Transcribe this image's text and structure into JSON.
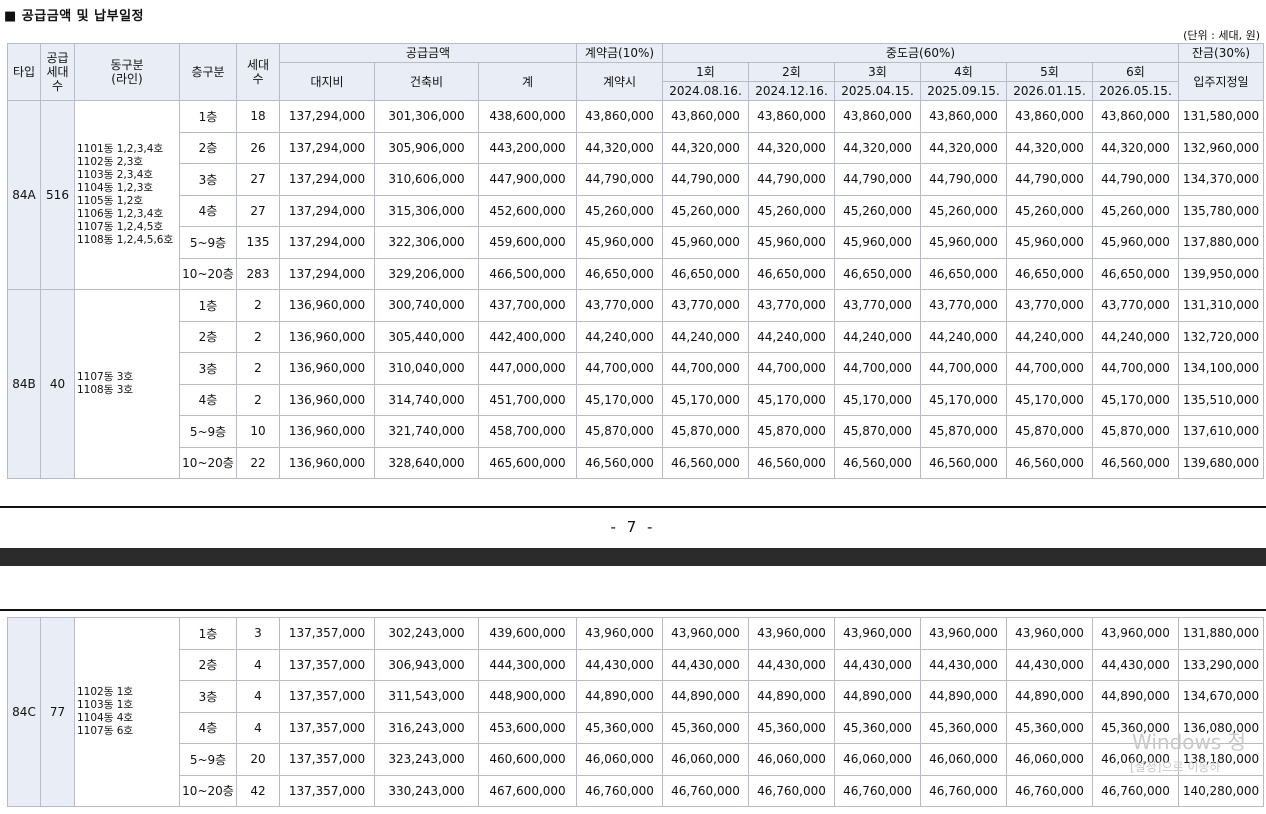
{
  "section_title": "■ 공급금액 및 납부일정",
  "unit_note": "(단위 : 세대, 원)",
  "headers": {
    "type": "타입",
    "supply_units": "공급\n세대\n수",
    "dong": "동구분\n(라인)",
    "floor": "층구분",
    "households": "세대\n수",
    "supply_amount": "공급금액",
    "land": "대지비",
    "building": "건축비",
    "total": "계",
    "deposit": "계약금(10%)",
    "deposit_sub": "계약시",
    "middle": "중도금(60%)",
    "rounds": [
      "1회",
      "2회",
      "3회",
      "4회",
      "5회",
      "6회"
    ],
    "dates": [
      "2024.08.16.",
      "2024.12.16.",
      "2025.04.15.",
      "2025.09.15.",
      "2026.01.15.",
      "2026.05.15."
    ],
    "balance": "잔금(30%)",
    "balance_sub": "입주지정일"
  },
  "page_number": "- 7 -",
  "watermark": {
    "line1": "Windows 정",
    "line2": "[설정]으로 이동하"
  },
  "groups": [
    {
      "type": "84A",
      "supply": "516",
      "dong": "1101동 1,2,3,4호\n1102동 2,3호\n1103동 2,3,4호\n1104동 1,2,3호\n1105동 1,2호\n1106동 1,2,3,4호\n1107동 1,2,4,5호\n1108동 1,2,4,5,6호",
      "rows": [
        {
          "floor": "1층",
          "hh": "18",
          "land": "137,294,000",
          "build": "301,306,000",
          "total": "438,600,000",
          "dep": "43,860,000",
          "mid": "43,860,000",
          "bal": "131,580,000"
        },
        {
          "floor": "2층",
          "hh": "26",
          "land": "137,294,000",
          "build": "305,906,000",
          "total": "443,200,000",
          "dep": "44,320,000",
          "mid": "44,320,000",
          "bal": "132,960,000"
        },
        {
          "floor": "3층",
          "hh": "27",
          "land": "137,294,000",
          "build": "310,606,000",
          "total": "447,900,000",
          "dep": "44,790,000",
          "mid": "44,790,000",
          "bal": "134,370,000"
        },
        {
          "floor": "4층",
          "hh": "27",
          "land": "137,294,000",
          "build": "315,306,000",
          "total": "452,600,000",
          "dep": "45,260,000",
          "mid": "45,260,000",
          "bal": "135,780,000"
        },
        {
          "floor": "5~9층",
          "hh": "135",
          "land": "137,294,000",
          "build": "322,306,000",
          "total": "459,600,000",
          "dep": "45,960,000",
          "mid": "45,960,000",
          "bal": "137,880,000"
        },
        {
          "floor": "10~20층",
          "hh": "283",
          "land": "137,294,000",
          "build": "329,206,000",
          "total": "466,500,000",
          "dep": "46,650,000",
          "mid": "46,650,000",
          "bal": "139,950,000"
        }
      ]
    },
    {
      "type": "84B",
      "supply": "40",
      "dong": "1107동 3호\n1108동 3호",
      "rows": [
        {
          "floor": "1층",
          "hh": "2",
          "land": "136,960,000",
          "build": "300,740,000",
          "total": "437,700,000",
          "dep": "43,770,000",
          "mid": "43,770,000",
          "bal": "131,310,000"
        },
        {
          "floor": "2층",
          "hh": "2",
          "land": "136,960,000",
          "build": "305,440,000",
          "total": "442,400,000",
          "dep": "44,240,000",
          "mid": "44,240,000",
          "bal": "132,720,000"
        },
        {
          "floor": "3층",
          "hh": "2",
          "land": "136,960,000",
          "build": "310,040,000",
          "total": "447,000,000",
          "dep": "44,700,000",
          "mid": "44,700,000",
          "bal": "134,100,000"
        },
        {
          "floor": "4층",
          "hh": "2",
          "land": "136,960,000",
          "build": "314,740,000",
          "total": "451,700,000",
          "dep": "45,170,000",
          "mid": "45,170,000",
          "bal": "135,510,000"
        },
        {
          "floor": "5~9층",
          "hh": "10",
          "land": "136,960,000",
          "build": "321,740,000",
          "total": "458,700,000",
          "dep": "45,870,000",
          "mid": "45,870,000",
          "bal": "137,610,000"
        },
        {
          "floor": "10~20층",
          "hh": "22",
          "land": "136,960,000",
          "build": "328,640,000",
          "total": "465,600,000",
          "dep": "46,560,000",
          "mid": "46,560,000",
          "bal": "139,680,000"
        }
      ]
    },
    {
      "type": "84C",
      "supply": "77",
      "dong": "1102동 1호\n1103동 1호\n1104동 4호\n1107동 6호",
      "rows": [
        {
          "floor": "1층",
          "hh": "3",
          "land": "137,357,000",
          "build": "302,243,000",
          "total": "439,600,000",
          "dep": "43,960,000",
          "mid": "43,960,000",
          "bal": "131,880,000"
        },
        {
          "floor": "2층",
          "hh": "4",
          "land": "137,357,000",
          "build": "306,943,000",
          "total": "444,300,000",
          "dep": "44,430,000",
          "mid": "44,430,000",
          "bal": "133,290,000"
        },
        {
          "floor": "3층",
          "hh": "4",
          "land": "137,357,000",
          "build": "311,543,000",
          "total": "448,900,000",
          "dep": "44,890,000",
          "mid": "44,890,000",
          "bal": "134,670,000"
        },
        {
          "floor": "4층",
          "hh": "4",
          "land": "137,357,000",
          "build": "316,243,000",
          "total": "453,600,000",
          "dep": "45,360,000",
          "mid": "45,360,000",
          "bal": "136,080,000"
        },
        {
          "floor": "5~9층",
          "hh": "20",
          "land": "137,357,000",
          "build": "323,243,000",
          "total": "460,600,000",
          "dep": "46,060,000",
          "mid": "46,060,000",
          "bal": "138,180,000"
        },
        {
          "floor": "10~20층",
          "hh": "42",
          "land": "137,357,000",
          "build": "330,243,000",
          "total": "467,600,000",
          "dep": "46,760,000",
          "mid": "46,760,000",
          "bal": "140,280,000"
        }
      ]
    }
  ]
}
